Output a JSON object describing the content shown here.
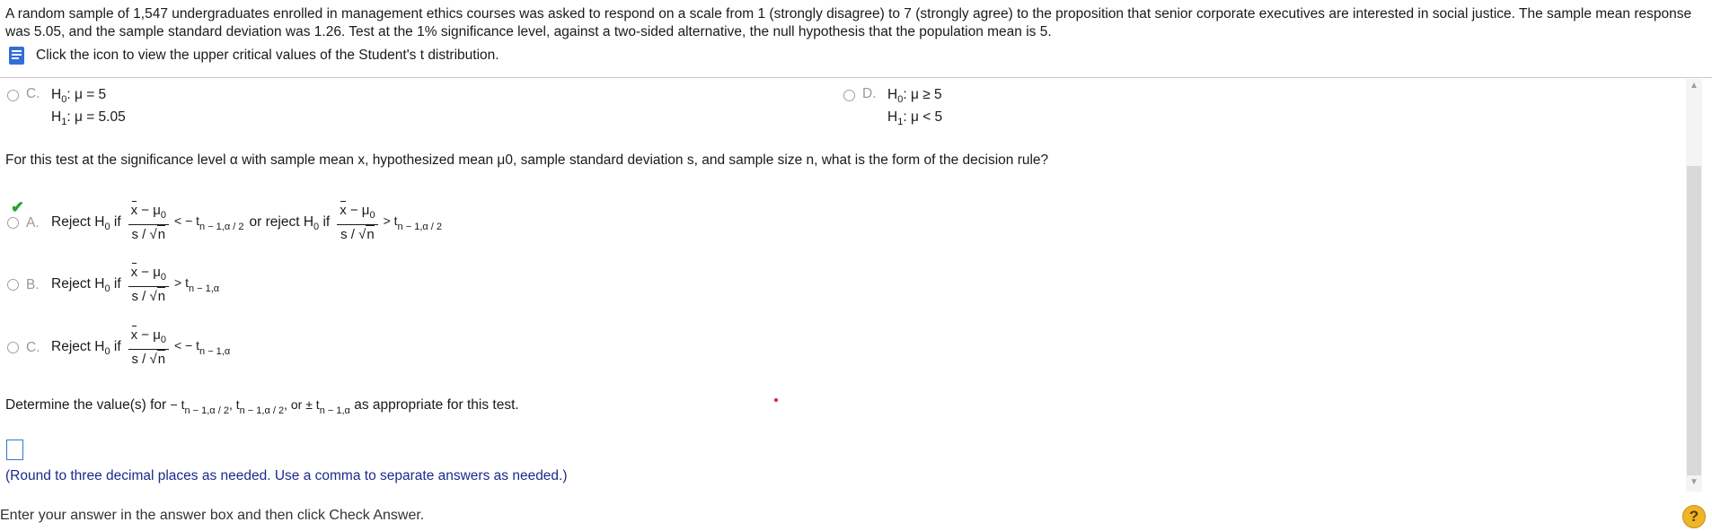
{
  "problem": {
    "text": "A random sample of 1,547 undergraduates enrolled in management ethics courses was asked to respond on a scale from 1 (strongly disagree) to 7 (strongly agree) to the proposition that senior corporate executives are interested in social justice. The sample mean response was 5.05, and the sample standard deviation was 1.26. Test at the 1% significance level, against a two-sided alternative, the null hypothesis that the population mean is 5.",
    "tip": "Click the icon to view the upper critical values of the Student's t distribution."
  },
  "hypotheses": {
    "c": {
      "letter": "C.",
      "h0": "μ = 5",
      "h1": "μ = 5.05"
    },
    "d": {
      "letter": "D.",
      "h0": "μ ≥ 5",
      "h1": "μ < 5"
    }
  },
  "question": "For this test at the significance level α with sample mean x, hypothesized mean μ0, sample standard deviation s, and sample size n, what is the form of the decision rule?",
  "rules": {
    "a": {
      "letter": "A.",
      "selected": true
    },
    "b": {
      "letter": "B."
    },
    "c": {
      "letter": "C."
    }
  },
  "determine": {
    "prefix": "Determine the value(s) for",
    "suffix": "as appropriate for this test."
  },
  "hint": "(Round to three decimal places as needed. Use a comma to separate answers as needed.)",
  "footer": "Enter your answer in the answer box and then click Check Answer.",
  "help_label": "?",
  "colors": {
    "accent": "#3377cc",
    "check": "#2e9e2e",
    "help": "#f0b429"
  }
}
